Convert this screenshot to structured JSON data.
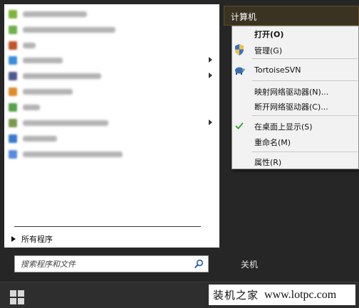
{
  "programs": {
    "items": [
      {
        "icon_color": "#7db43a",
        "label_width": 90,
        "has_arrow": false
      },
      {
        "icon_color": "#6fb04a",
        "label_width": 130,
        "has_arrow": false
      },
      {
        "icon_color": "#c2542a",
        "label_width": 18,
        "has_arrow": false
      },
      {
        "icon_color": "#3a8ee0",
        "label_width": 56,
        "has_arrow": true
      },
      {
        "icon_color": "#4f5a8e",
        "label_width": 110,
        "has_arrow": true
      },
      {
        "icon_color": "#e08a2a",
        "label_width": 70,
        "has_arrow": false
      },
      {
        "icon_color": "#5aa04a",
        "label_width": 24,
        "has_arrow": false
      },
      {
        "icon_color": "#7a9a4a",
        "label_width": 120,
        "has_arrow": true
      },
      {
        "icon_color": "#3a7ad0",
        "label_width": 48,
        "has_arrow": false
      },
      {
        "icon_color": "#5a8ae0",
        "label_width": 140,
        "has_arrow": false
      }
    ],
    "all_programs_label": "所有程序"
  },
  "search": {
    "placeholder": "搜索程序和文件",
    "icon": "search-icon"
  },
  "right_panel": {
    "computer_label": "计算机",
    "shutdown_label": "关机"
  },
  "context_menu": {
    "items": [
      {
        "label": "打开(O)",
        "bold": true,
        "icon": ""
      },
      {
        "label": "管理(G)",
        "bold": false,
        "icon": "shield-icon"
      },
      {
        "label": "TortoiseSVN",
        "bold": false,
        "icon": "tortoise-icon"
      },
      {
        "label": "映射网络驱动器(N)...",
        "bold": false,
        "icon": ""
      },
      {
        "label": "断开网络驱动器(C)...",
        "bold": false,
        "icon": ""
      },
      {
        "label": "在桌面上显示(S)",
        "bold": false,
        "icon": "checkmark-icon"
      },
      {
        "label": "重命名(M)",
        "bold": false,
        "icon": ""
      },
      {
        "label": "属性(R)",
        "bold": false,
        "icon": ""
      }
    ]
  },
  "taskbar": {
    "start_icon": "windows-logo-icon",
    "watermark_cn": "装机之家",
    "watermark_url": "www.lotpc.com"
  },
  "colors": {
    "menu_bg": "#f2f2f2",
    "taskbar_bg": "#2e2e2e",
    "start_menu_bg": "#262626",
    "highlight_border": "#5e4d26",
    "check_green": "#3aa83a"
  }
}
